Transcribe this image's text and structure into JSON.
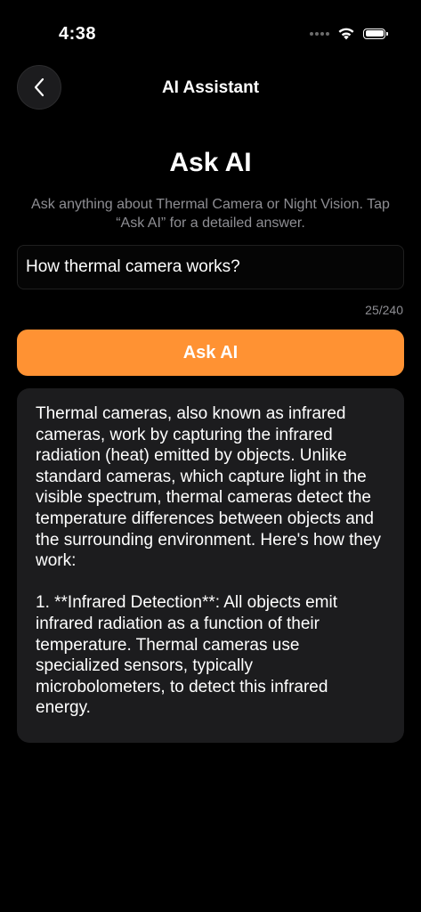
{
  "status_bar": {
    "time": "4:38"
  },
  "nav": {
    "back_icon": "chevron-left-icon",
    "title": "AI Assistant"
  },
  "main": {
    "title": "Ask AI",
    "subtitle": "Ask anything about Thermal Camera or Night Vision. Tap “Ask AI” for a detailed answer.",
    "question": {
      "value": "How thermal camera works?",
      "placeholder": ""
    },
    "char_count": "25/240",
    "ask_button_label": "Ask AI",
    "answer": "Thermal cameras, also known as infrared cameras, work by capturing the infrared radiation (heat) emitted by objects. Unlike standard cameras, which capture light in the visible spectrum, thermal cameras detect the temperature differences between objects and the surrounding environment. Here's how they work:\n\n1. **Infrared Detection**: All objects emit infrared radiation as a function of their temperature. Thermal cameras use specialized sensors, typically microbolometers, to detect this infrared energy."
  },
  "colors": {
    "accent": "#ff9233",
    "background": "#000000",
    "card": "#1c1c1e",
    "secondary_text": "#8e8e93"
  }
}
